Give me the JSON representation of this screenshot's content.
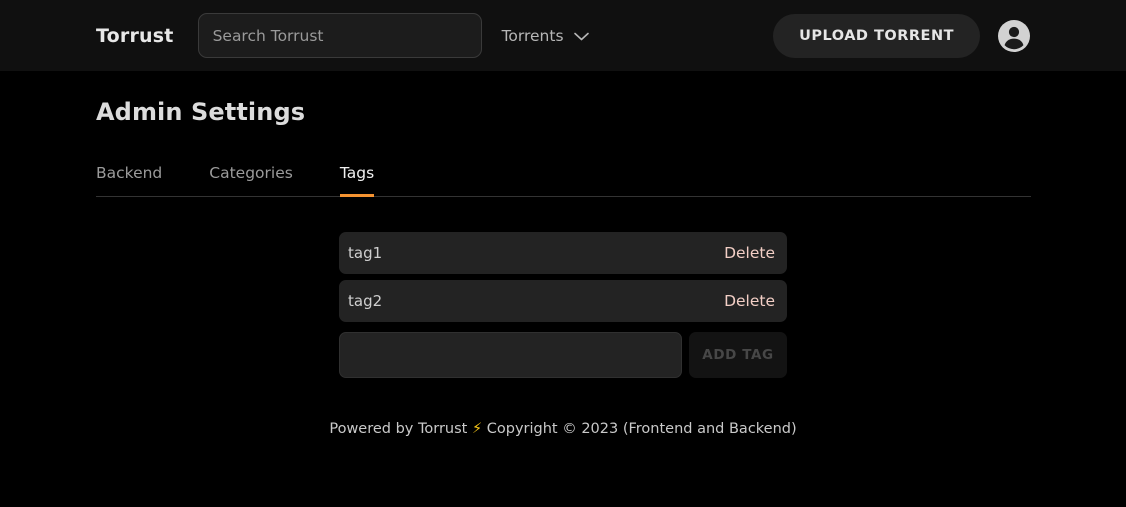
{
  "header": {
    "brand": "Torrust",
    "search": {
      "placeholder": "Search Torrust",
      "value": ""
    },
    "menu": {
      "label": "Torrents",
      "chevron_icon": "chevron-down-icon"
    },
    "upload_button": "UPLOAD TORRENT",
    "avatar_icon": "user-avatar-icon"
  },
  "page": {
    "title": "Admin Settings",
    "tabs": [
      {
        "label": "Backend",
        "active": false
      },
      {
        "label": "Categories",
        "active": false
      },
      {
        "label": "Tags",
        "active": true
      }
    ]
  },
  "tags": {
    "rows": [
      {
        "name": "tag1",
        "delete_label": "Delete"
      },
      {
        "name": "tag2",
        "delete_label": "Delete"
      }
    ],
    "add": {
      "input_value": "",
      "input_placeholder": "",
      "button_label": "ADD TAG"
    }
  },
  "footer": {
    "prefix": "Powered by Torrust",
    "bolt_icon": "⚡",
    "suffix": "Copyright © 2023 (Frontend and Backend)"
  },
  "colors": {
    "page_background": "#000000",
    "header_background": "#101010",
    "accent": "#f59331",
    "row_background": "#232323",
    "delete_text": "#f3cfc6",
    "bolt_yellow": "#f5c518"
  }
}
